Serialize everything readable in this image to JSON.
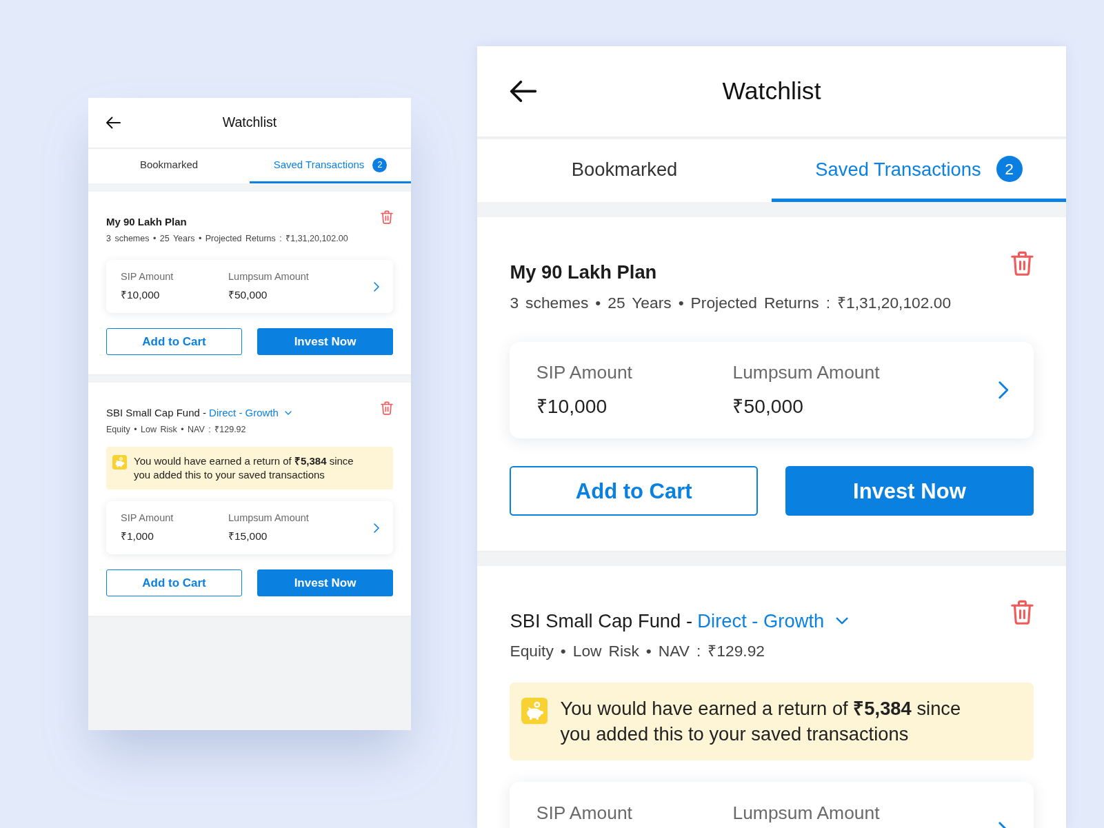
{
  "screens": [
    {
      "header": {
        "title": "Watchlist"
      },
      "tabs": [
        {
          "label": "Bookmarked",
          "selected": false
        },
        {
          "label": "Saved Transactions",
          "selected": true,
          "badge": "2"
        }
      ],
      "cards": [
        {
          "title": "My 90 Lakh Plan",
          "details": "3 schemes • 25 Years • Projected Returns : ₹1,31,20,102.00",
          "amounts": [
            {
              "label": "SIP Amount",
              "value": "₹10,000"
            },
            {
              "label": "Lumpsum Amount",
              "value": "₹50,000"
            }
          ],
          "buttons": [
            {
              "label": "Add to Cart",
              "kind": "outline"
            },
            {
              "label": "Invest Now",
              "kind": "primary"
            }
          ]
        },
        {
          "title": "SBI Small Cap Fund -",
          "variant": "Direct - Growth",
          "details": "Equity • Low Risk • NAV : ₹129.92",
          "notice": "You would have earned a return of **₹5,384** since you added this to your saved transactions",
          "amounts": [
            {
              "label": "SIP Amount",
              "value": "₹1,000"
            },
            {
              "label": "Lumpsum Amount",
              "value": "₹15,000"
            }
          ],
          "buttons": [
            {
              "label": "Add to Cart",
              "kind": "outline"
            },
            {
              "label": "Invest Now",
              "kind": "primary"
            }
          ]
        }
      ]
    },
    {
      "header": {
        "title": "Watchlist"
      },
      "tabs": [
        {
          "label": "Bookmarked",
          "selected": false
        },
        {
          "label": "Saved Transactions",
          "selected": true,
          "badge": "2"
        }
      ],
      "cards": [
        {
          "title": "My 90 Lakh Plan",
          "details": "3 schemes • 25 Years • Projected Returns : ₹1,31,20,102.00",
          "amounts": [
            {
              "label": "SIP Amount",
              "value": "₹10,000"
            },
            {
              "label": "Lumpsum Amount",
              "value": "₹50,000"
            }
          ],
          "buttons": [
            {
              "label": "Add to Cart",
              "kind": "outline"
            },
            {
              "label": "Invest Now",
              "kind": "primary"
            }
          ]
        },
        {
          "title": "SBI Small Cap Fund -",
          "variant": "Direct - Growth",
          "details": "Equity • Low Risk • NAV : ₹129.92",
          "notice": "You would have earned a return of **₹5,384** since you added this to your saved transactions",
          "amounts": [
            {
              "label": "SIP Amount"
            },
            {
              "label": "Lumpsum Amount"
            }
          ]
        }
      ]
    }
  ]
}
